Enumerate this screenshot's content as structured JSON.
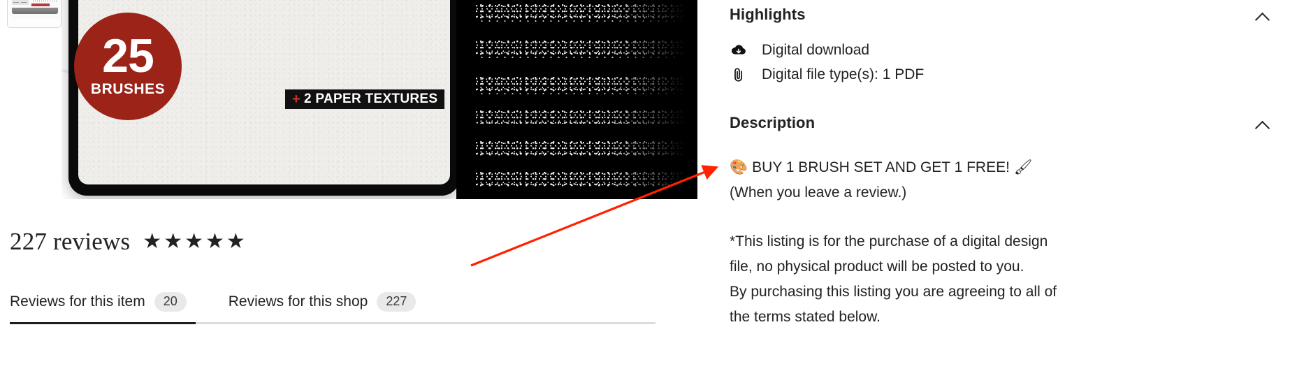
{
  "product_image": {
    "thumbnail_name": "product-thumbnail",
    "brush_badge": {
      "count": "25",
      "label": "BRUSHES"
    },
    "texture_ribbon": {
      "plus": "+",
      "label": "2 PAPER TEXTURES"
    }
  },
  "reviews": {
    "heading": "227 reviews",
    "stars": [
      "★",
      "★",
      "★",
      "★",
      "★"
    ],
    "star_count": 5,
    "tabs": [
      {
        "label": "Reviews for this item",
        "badge": "20",
        "active": true
      },
      {
        "label": "Reviews for this shop",
        "badge": "227",
        "active": false
      }
    ]
  },
  "highlights": {
    "title": "Highlights",
    "chevron": "chevron-up",
    "items": [
      {
        "icon": "download-cloud-icon",
        "label": "Digital download"
      },
      {
        "icon": "paperclip-icon",
        "label": "Digital file type(s): 1 PDF"
      }
    ]
  },
  "description": {
    "title": "Description",
    "chevron": "chevron-up",
    "promo_emoji_left": "🎨",
    "promo_text": "BUY 1 BRUSH SET AND GET 1 FREE!",
    "promo_emoji_right": "🖌",
    "promo_sub": "(When you leave a review.)",
    "terms_lines": [
      "*This listing is for the purchase of a digital design",
      "file, no physical product will be posted to you.",
      "By purchasing this listing you are agreeing to all of",
      "the terms stated below."
    ]
  },
  "annotation": {
    "type": "arrow",
    "color": "#FF2200",
    "points_to": "promo-line"
  },
  "colors": {
    "badge_red": "#9B2318",
    "ribbon_black": "#111111",
    "text": "#222222",
    "tab_badge_bg": "#E9E9E9",
    "active_underline": "#1D1D1D",
    "annotation_red": "#FF2200"
  }
}
